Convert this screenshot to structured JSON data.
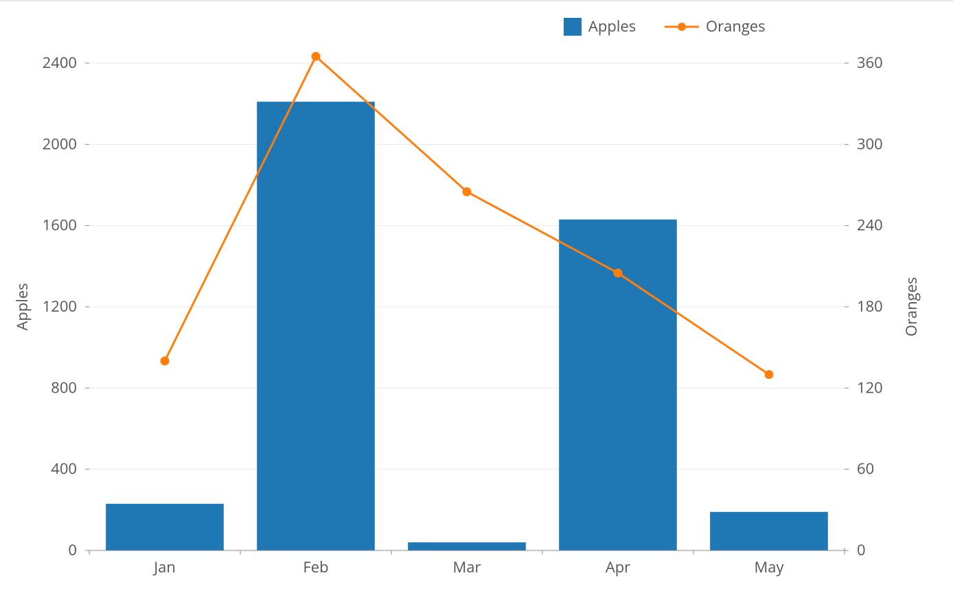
{
  "chart_data": {
    "type": "bar+line",
    "categories": [
      "Jan",
      "Feb",
      "Mar",
      "Apr",
      "May"
    ],
    "series": [
      {
        "name": "Apples",
        "type": "bar",
        "axis": "left",
        "color": "#1f77b4",
        "values": [
          230,
          2210,
          40,
          1630,
          190
        ]
      },
      {
        "name": "Oranges",
        "type": "line",
        "axis": "right",
        "color": "#ff7f0e",
        "values": [
          140,
          365,
          265,
          205,
          130
        ]
      }
    ],
    "ylabel_left": "Apples",
    "ylabel_right": "Oranges",
    "ylim_left": [
      0,
      2400
    ],
    "ylim_right": [
      0,
      360
    ],
    "y_ticks_left": [
      0,
      400,
      800,
      1200,
      1600,
      2000,
      2400
    ],
    "y_ticks_right": [
      0,
      60,
      120,
      180,
      240,
      300,
      360
    ],
    "legend": [
      "Apples",
      "Oranges"
    ]
  }
}
